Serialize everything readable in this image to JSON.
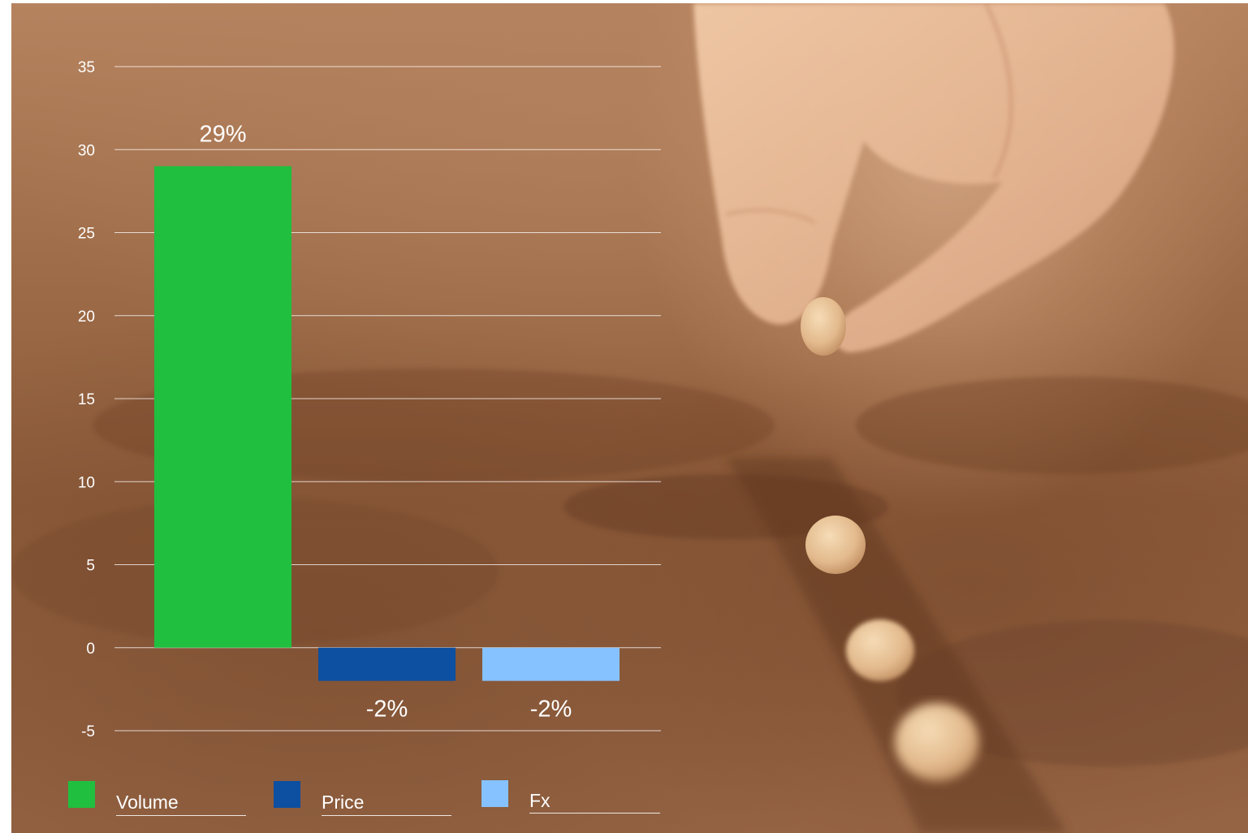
{
  "colors": {
    "volume": "#20bf3f",
    "price": "#0d4fa0",
    "fx": "#86c2ff",
    "gridline": "#ffffff"
  },
  "chart_data": {
    "type": "bar",
    "categories": [
      "Volume",
      "Price",
      "Fx"
    ],
    "values": [
      29,
      -2,
      -2
    ],
    "data_labels": [
      "29%",
      "-2%",
      "-2%"
    ],
    "series_colors": [
      "#20bf3f",
      "#0d4fa0",
      "#86c2ff"
    ],
    "ylim": [
      -5,
      35
    ],
    "yticks": [
      35,
      30,
      25,
      20,
      15,
      10,
      5,
      0,
      -5
    ],
    "grid": true,
    "legend_position": "bottom",
    "title": "",
    "xlabel": "",
    "ylabel": ""
  },
  "legend": [
    {
      "label": "Volume",
      "color": "#20bf3f"
    },
    {
      "label": "Price",
      "color": "#0d4fa0"
    },
    {
      "label": "Fx",
      "color": "#86c2ff"
    }
  ]
}
